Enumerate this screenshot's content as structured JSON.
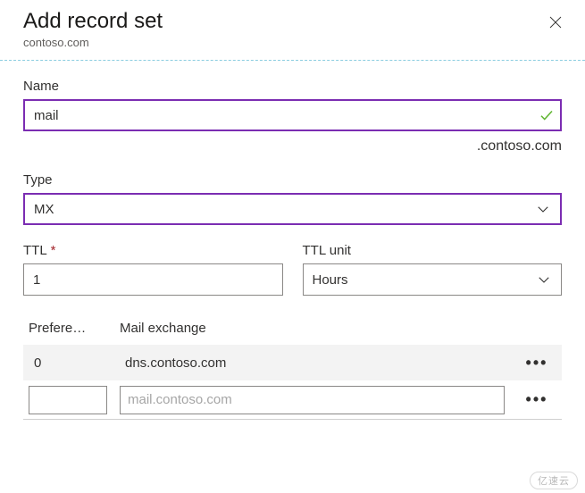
{
  "header": {
    "title": "Add record set",
    "subtitle": "contoso.com"
  },
  "name_field": {
    "label": "Name",
    "value": "mail",
    "suffix": ".contoso.com"
  },
  "type_field": {
    "label": "Type",
    "value": "MX"
  },
  "ttl_field": {
    "label": "TTL",
    "value": "1"
  },
  "ttl_unit_field": {
    "label": "TTL unit",
    "value": "Hours"
  },
  "mx": {
    "col_preference": "Prefere…",
    "col_exchange": "Mail exchange",
    "rows": [
      {
        "preference": "0",
        "exchange": "dns.contoso.com"
      }
    ],
    "new_row": {
      "preference": "",
      "exchange_placeholder": "mail.contoso.com"
    }
  },
  "watermark": "亿速云"
}
